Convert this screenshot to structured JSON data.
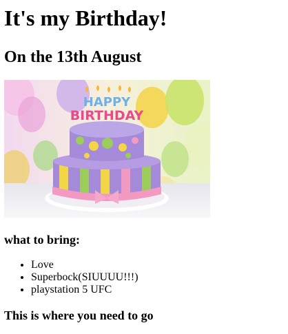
{
  "page": {
    "title": "It's my Birthday!",
    "subtitle": "On the 13th August",
    "image": {
      "alt": "Birthday cake with \"HAPPY BIRTHDAY\" candles",
      "candles_text_top": "HAPPY",
      "candles_text_bottom": "BIRTHDAY"
    },
    "bring_heading": "what to bring:",
    "bring_items": [
      "Love",
      "Superbock(SIUUUU!!!)",
      "playstation 5 UFC"
    ],
    "location_heading": "This is where you need to go"
  },
  "colors": {
    "text": "#000000",
    "background": "#ffffff",
    "cake_purple": "#a48ad8",
    "cake_yellow": "#f2d646",
    "cake_green": "#9ccc5a",
    "cake_pink": "#f29ac2"
  }
}
